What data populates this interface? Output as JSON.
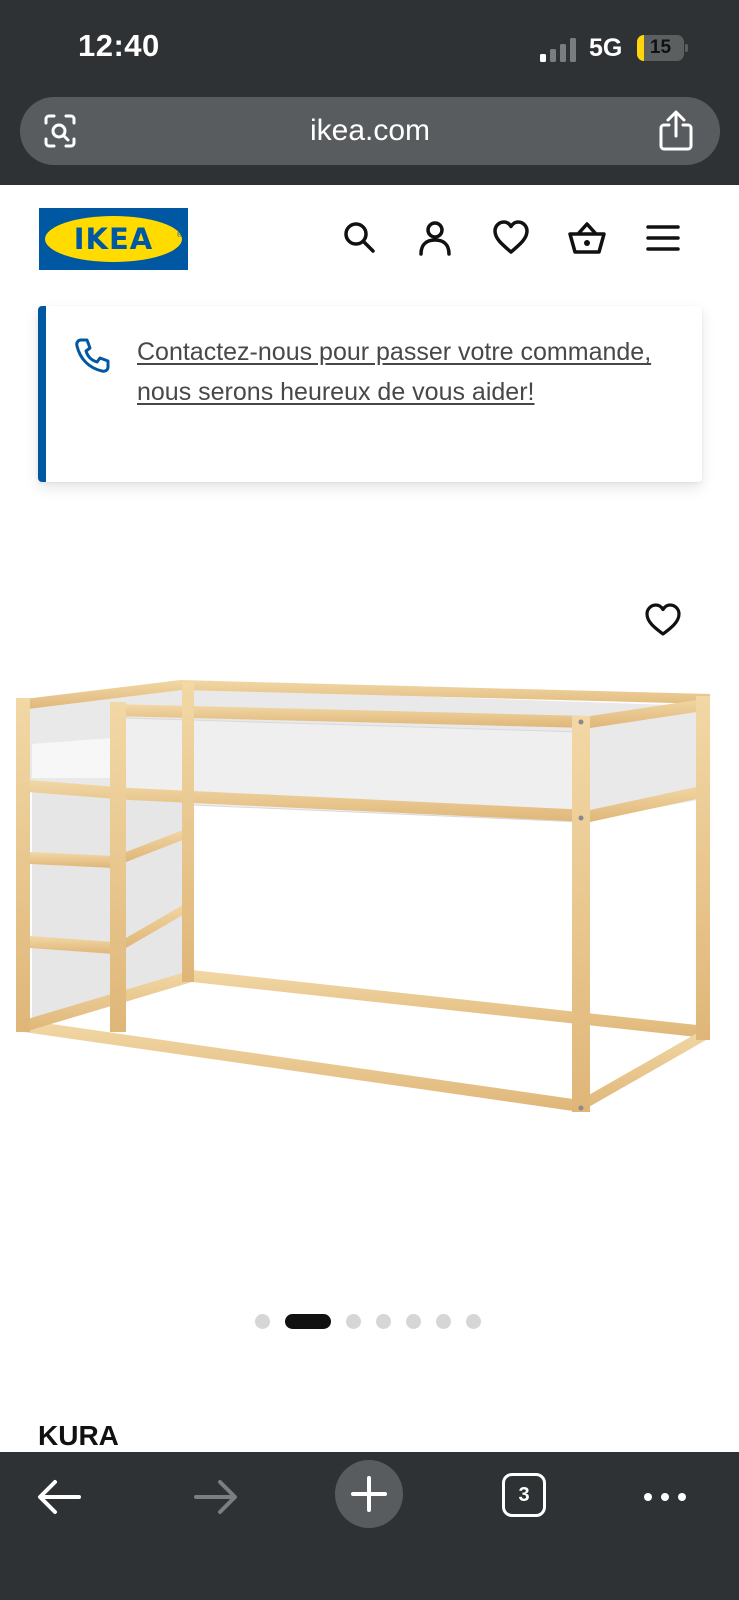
{
  "status_bar": {
    "time": "12:40",
    "network": "5G",
    "battery": "15",
    "battery_level": 0.15
  },
  "browser": {
    "url": "ikea.com",
    "tab_count": "3"
  },
  "site_header": {
    "logo_text": "IKEA",
    "icons": [
      "search-icon",
      "account-icon",
      "heart-icon",
      "basket-icon",
      "menu-icon"
    ]
  },
  "contact_banner": {
    "text": "Contactez-nous pour passer votre commande, nous serons heureux de vous aider!",
    "accent": "#0058a3"
  },
  "product": {
    "name": "KURA",
    "image": "loft-bed-image",
    "carousel": {
      "count": 7,
      "active_index": 1
    }
  },
  "colors": {
    "ikea_blue": "#0058a3",
    "ikea_yellow": "#ffdb00",
    "browser_chrome": "#2f3234"
  }
}
